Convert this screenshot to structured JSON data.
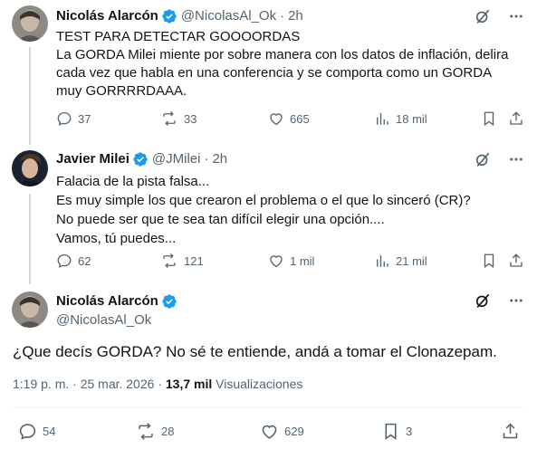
{
  "tweets": [
    {
      "name": "Nicolás Alarcón",
      "handle": "@NicolasAl_Ok",
      "time": "2h",
      "lines": [
        "TEST PARA DETECTAR GOOOORDAS",
        "La GORDA Milei miente por sobre manera con los datos de inflación, delira",
        "cada vez que habla en una conferencia y se comporta como un GORDA",
        "muy GORRRRDAAA."
      ],
      "replies": "37",
      "reposts": "33",
      "likes": "665",
      "views": "18 mil"
    },
    {
      "name": "Javier Milei",
      "handle": "@JMilei",
      "time": "2h",
      "lines": [
        "Falacia de la pista falsa...",
        "Es muy simple los que crearon el problema o el que lo sinceró (CR)?",
        "No puede ser que te sea tan difícil elegir una opción....",
        "Vamos, tú puedes..."
      ],
      "replies": "62",
      "reposts": "121",
      "likes": "1 mil",
      "views": "21 mil"
    }
  ],
  "main": {
    "name": "Nicolás Alarcón",
    "handle": "@NicolasAl_Ok",
    "text": "¿Que decís GORDA? No sé te entiende, andá a tomar el Clonazepam.",
    "timestamp": "1:19 p. m. · 25 mar. 2026 ·",
    "views_count": "13,7 mil",
    "views_label": "Visualizaciones",
    "replies": "54",
    "reposts": "28",
    "likes": "629",
    "bookmarks": "3"
  },
  "colors": {
    "verified": "#1d9bf0",
    "muted": "#536471",
    "text": "#0f1419"
  }
}
